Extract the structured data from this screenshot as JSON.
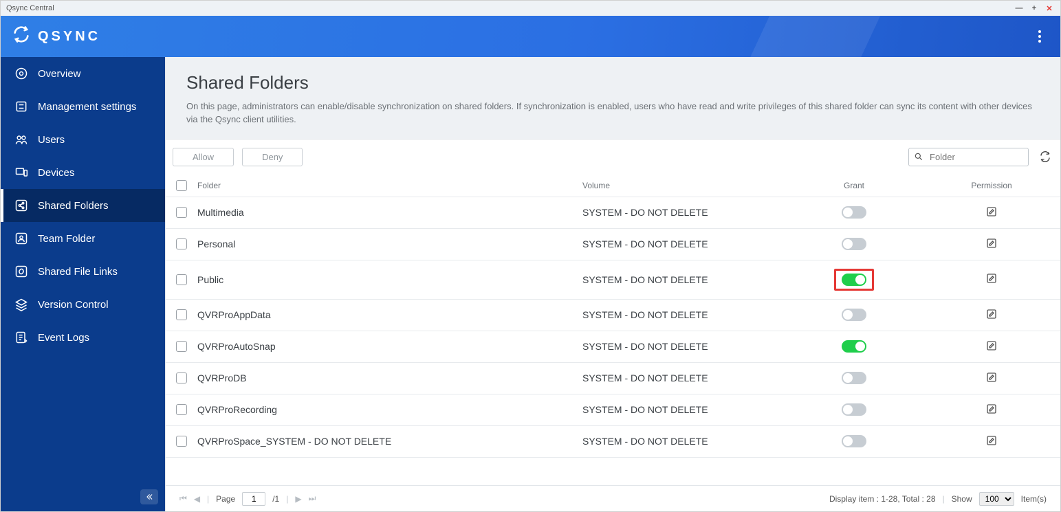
{
  "window_title": "Qsync Central",
  "brand": "QSYNC",
  "sidebar": {
    "items": [
      {
        "label": "Overview",
        "icon": "eye"
      },
      {
        "label": "Management settings",
        "icon": "sliders"
      },
      {
        "label": "Users",
        "icon": "users"
      },
      {
        "label": "Devices",
        "icon": "devices"
      },
      {
        "label": "Shared Folders",
        "icon": "share",
        "active": true
      },
      {
        "label": "Team Folder",
        "icon": "team"
      },
      {
        "label": "Shared File Links",
        "icon": "link"
      },
      {
        "label": "Version Control",
        "icon": "layers"
      },
      {
        "label": "Event Logs",
        "icon": "log"
      }
    ]
  },
  "page": {
    "title": "Shared Folders",
    "description": "On this page, administrators can enable/disable synchronization on shared folders. If synchronization is enabled, users who have read and write privileges of this shared folder can sync its content with other devices via the Qsync client utilities."
  },
  "toolbar": {
    "allow_label": "Allow",
    "deny_label": "Deny",
    "search_placeholder": "Folder"
  },
  "table": {
    "headers": {
      "folder": "Folder",
      "volume": "Volume",
      "grant": "Grant",
      "permission": "Permission"
    },
    "rows": [
      {
        "folder": "Multimedia",
        "volume": "SYSTEM - DO NOT DELETE",
        "grant": false,
        "highlight": false
      },
      {
        "folder": "Personal",
        "volume": "SYSTEM - DO NOT DELETE",
        "grant": false,
        "highlight": false
      },
      {
        "folder": "Public",
        "volume": "SYSTEM - DO NOT DELETE",
        "grant": true,
        "highlight": true
      },
      {
        "folder": "QVRProAppData",
        "volume": "SYSTEM - DO NOT DELETE",
        "grant": false,
        "highlight": false
      },
      {
        "folder": "QVRProAutoSnap",
        "volume": "SYSTEM - DO NOT DELETE",
        "grant": true,
        "highlight": false
      },
      {
        "folder": "QVRProDB",
        "volume": "SYSTEM - DO NOT DELETE",
        "grant": false,
        "highlight": false
      },
      {
        "folder": "QVRProRecording",
        "volume": "SYSTEM - DO NOT DELETE",
        "grant": false,
        "highlight": false
      },
      {
        "folder": "QVRProSpace_SYSTEM - DO NOT DELETE",
        "volume": "SYSTEM - DO NOT DELETE",
        "grant": false,
        "highlight": false
      }
    ]
  },
  "footer": {
    "page_label": "Page",
    "current_page": "1",
    "total_pages": "/1",
    "display_text": "Display item : 1-28, Total : 28",
    "show_label": "Show",
    "page_size": "100",
    "items_label": "Item(s)"
  }
}
